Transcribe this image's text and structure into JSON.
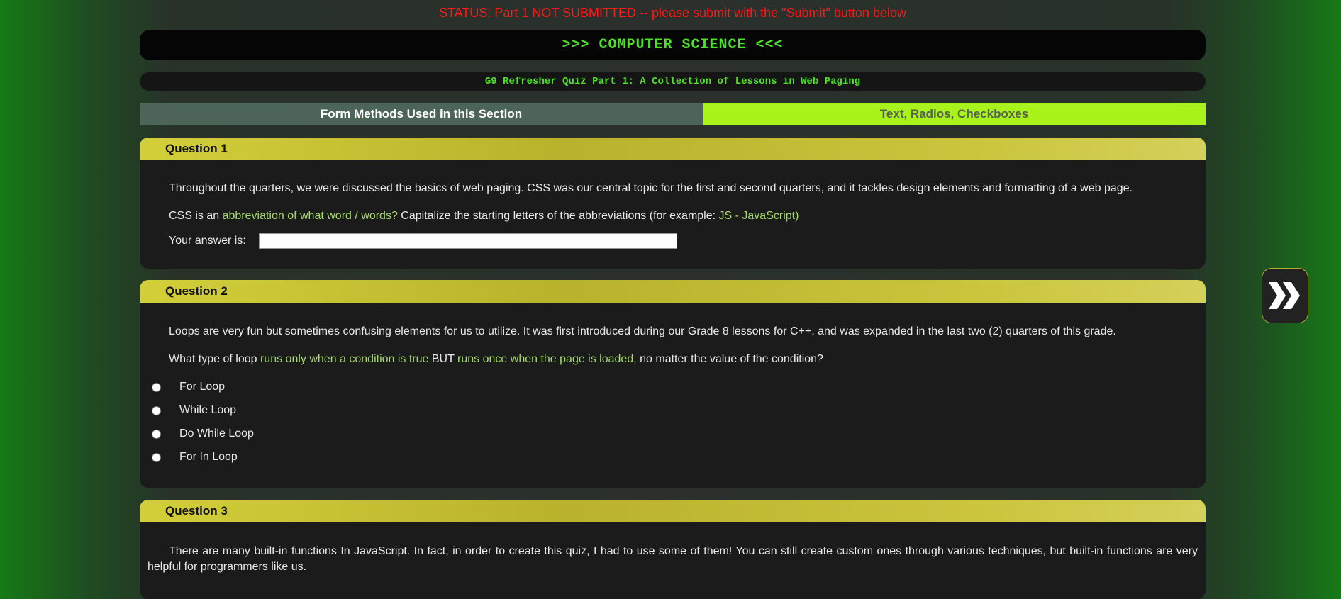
{
  "status": "STATUS: Part 1 NOT SUBMITTED -- please submit with the \"Submit\" button below",
  "header": {
    "title": ">>> COMPUTER SCIENCE <<<",
    "subtitle": "G9 Refresher Quiz Part 1: A Collection of Lessons in Web Paging"
  },
  "methods": {
    "label": "Form Methods Used in this Section",
    "value": "Text, Radios, Checkboxes"
  },
  "q1": {
    "heading": "Question 1",
    "intro": "Throughout the quarters, we were discussed the basics of web paging. CSS was our central topic for the first and second quarters, and it tackles design elements and formatting of a web page.",
    "prompt_a": "CSS is an ",
    "prompt_hl1": "abbreviation of what word / words?",
    "prompt_b": " Capitalize the starting letters of the abbreviations (for example: ",
    "prompt_hl2": "JS - JavaScript)",
    "answer_label": "Your answer is:",
    "answer_value": ""
  },
  "q2": {
    "heading": "Question 2",
    "intro": "Loops are very fun but sometimes confusing elements for us to utilize. It was first introduced during our Grade 8 lessons for C++, and was expanded in the last two (2) quarters of this grade.",
    "prompt_a": "What type of loop ",
    "prompt_hl1": "runs only when a condition is true",
    "prompt_b": " BUT ",
    "prompt_hl2": "runs once when the page is loaded,",
    "prompt_c": " no matter the value of the condition?",
    "options": [
      "For Loop",
      "While Loop",
      "Do While Loop",
      "For In Loop"
    ]
  },
  "q3": {
    "heading": "Question 3",
    "intro": "There are many built-in functions In JavaScript. In fact, in order to create this quiz, I had to use some of them! You can still create custom ones through various techniques, but built-in functions are very helpful for programmers like us."
  },
  "colors": {
    "status": "#ff1a1a",
    "accent_green": "#4ee02a",
    "question_header": "#d2cf3a",
    "highlight": "#a6d86c"
  },
  "icons": {
    "next": "double-chevron-right-icon"
  }
}
